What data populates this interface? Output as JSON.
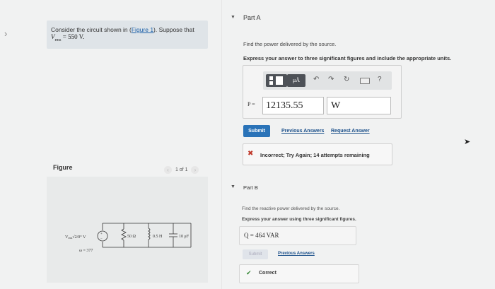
{
  "left_panel": {
    "nav_arrow": "›",
    "problem": {
      "text_before": "Consider the circuit shown in (",
      "figure_link": "Figure 1",
      "text_after": "). Suppose that",
      "given": "V",
      "given_sub": "rms",
      "given_value": " = 550 V."
    },
    "figure_label": "Figure",
    "pager": {
      "prev": "‹",
      "text": "1 of 1",
      "next": "›"
    },
    "circuit": {
      "source_label": "V",
      "source_sub": "rms",
      "source_rest": "√2/0° V",
      "omega": "ω = 377",
      "resistor": "50 Ω",
      "inductor": "0.5 H",
      "capacitor": "10 μF"
    }
  },
  "part_a": {
    "title": "Part A",
    "question": "Find the power delivered by the source.",
    "instruction": "Express your answer to three significant figures and include the appropriate units.",
    "toolbar": {
      "units_label": "μÅ",
      "undo": "↶",
      "redo": "↷",
      "reset": "↻",
      "help": "?"
    },
    "variable_label": "P =",
    "value": "12135.55",
    "unit": "W",
    "submit_label": "Submit",
    "previous_answers": "Previous Answers",
    "request_answer": "Request Answer",
    "feedback_icon": "✖",
    "feedback": "Incorrect; Try Again; 14 attempts remaining"
  },
  "part_b": {
    "title": "Part B",
    "question": "Find the reactive power delivered by the source.",
    "instruction": "Express your answer using three significant figures.",
    "answer": "Q = 464 VAR",
    "submit_label": "Submit",
    "previous_answers": "Previous Answers",
    "correct_icon": "✔",
    "correct": "Correct"
  },
  "colors": {
    "submit_blue": "#2a73b8",
    "link_blue": "#1a4f8a",
    "incorrect_red": "#c0392b",
    "correct_green": "#3a8a3a"
  }
}
